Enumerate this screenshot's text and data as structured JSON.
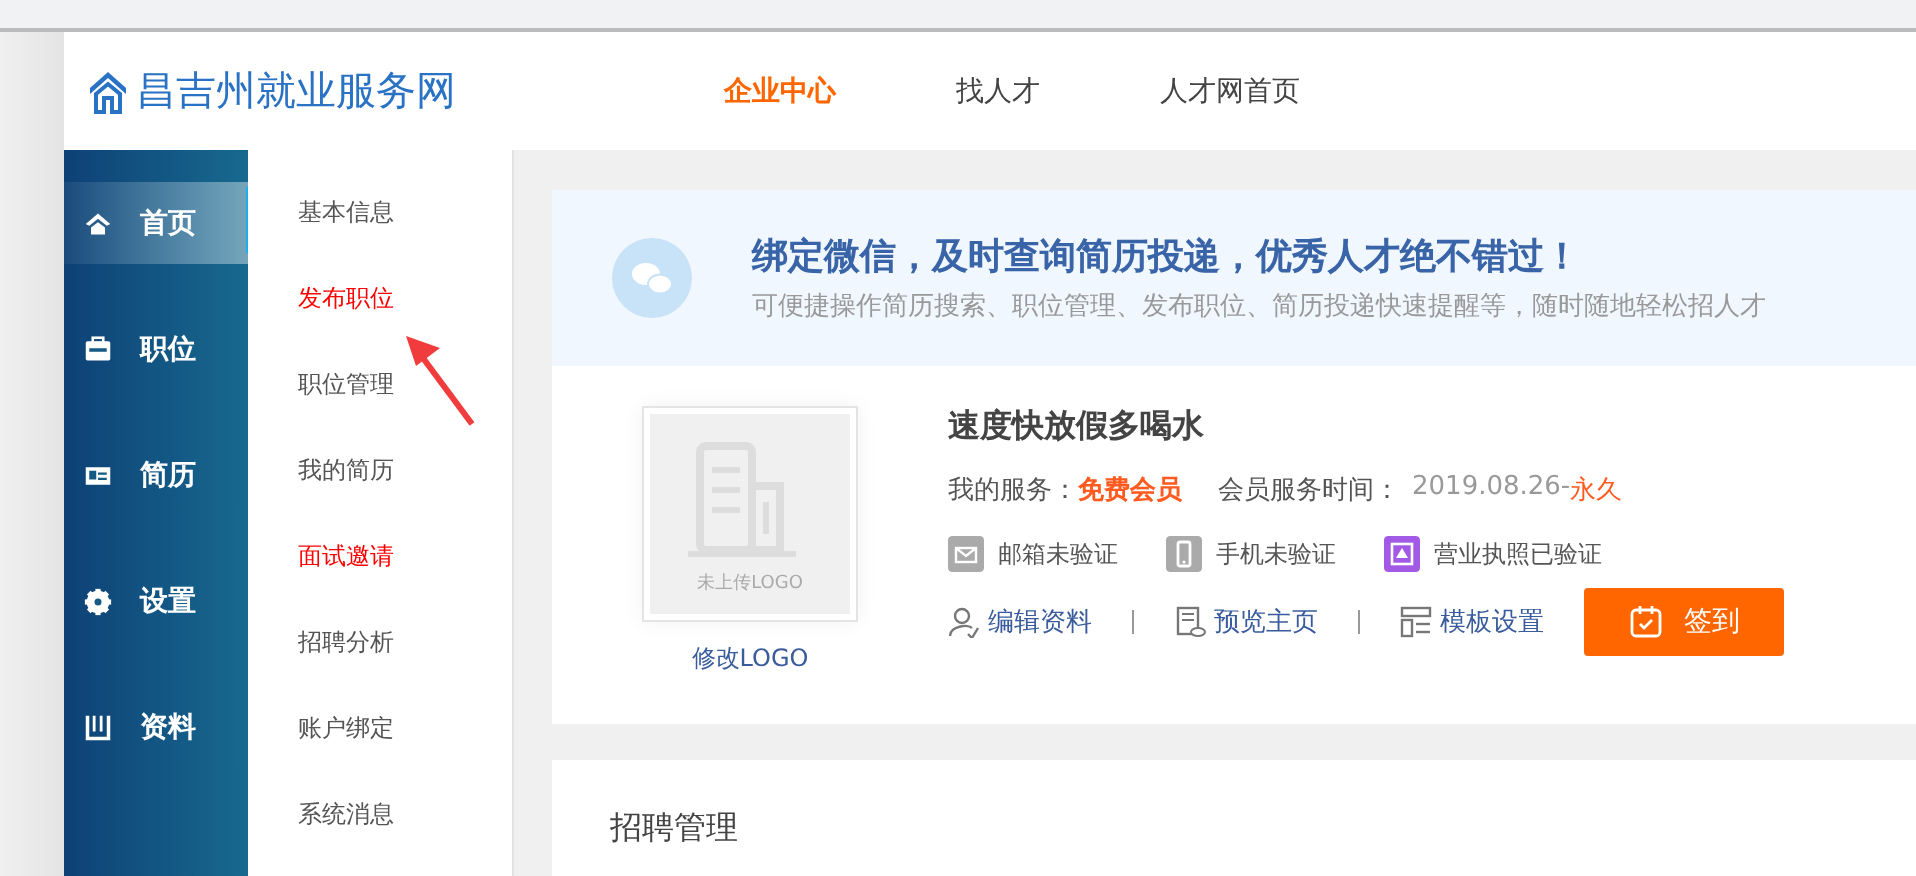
{
  "header": {
    "logo_text": "昌吉州就业服务网",
    "nav": [
      {
        "label": "企业中心",
        "selected": true
      },
      {
        "label": "找人才",
        "selected": false
      },
      {
        "label": "人才网首页",
        "selected": false
      }
    ]
  },
  "sidebar": {
    "items": [
      {
        "label": "首页",
        "kind": "home",
        "selected": true
      },
      {
        "label": "职位",
        "kind": "job",
        "selected": false
      },
      {
        "label": "简历",
        "kind": "resume",
        "selected": false
      },
      {
        "label": "设置",
        "kind": "settings",
        "selected": false
      },
      {
        "label": "资料",
        "kind": "docs",
        "selected": false
      }
    ]
  },
  "submenu": {
    "items": [
      {
        "label": "基本信息",
        "color": "#555555"
      },
      {
        "label": "发布职位",
        "color": "#ff0000"
      },
      {
        "label": "职位管理",
        "color": "#555555"
      },
      {
        "label": "我的简历",
        "color": "#555555"
      },
      {
        "label": "面试邀请",
        "color": "#ff0000"
      },
      {
        "label": "招聘分析",
        "color": "#555555"
      },
      {
        "label": "账户绑定",
        "color": "#555555"
      },
      {
        "label": "系统消息",
        "color": "#555555"
      }
    ]
  },
  "banner": {
    "title": "绑定微信，及时查询简历投递，优秀人才绝不错过！",
    "subtitle": "可便捷操作简历搜索、职位管理、发布职位、简历投递快速提醒等，随时随地轻松招人才"
  },
  "profile": {
    "logo_placeholder": "未上传LOGO",
    "change_logo": "修改LOGO",
    "company": "速度快放假多喝水",
    "service_label": "我的服务：",
    "service_value": "免费会员",
    "period_label": "会员服务时间：",
    "period_start": "2019.08.26-",
    "period_end": "永久",
    "verifications": [
      {
        "kind": "email",
        "label": "邮箱未验证",
        "verified": false
      },
      {
        "kind": "phone",
        "label": "手机未验证",
        "verified": false
      },
      {
        "kind": "license",
        "label": "营业执照已验证",
        "verified": true
      }
    ],
    "links": [
      {
        "kind": "edit",
        "label": "编辑资料"
      },
      {
        "kind": "preview",
        "label": "预览主页"
      },
      {
        "kind": "template",
        "label": "模板设置"
      }
    ],
    "sign_button": "签到"
  },
  "section": {
    "title": "招聘管理"
  }
}
